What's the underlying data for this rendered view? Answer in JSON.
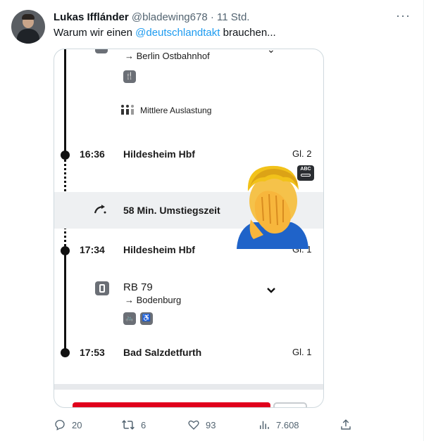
{
  "tweet": {
    "name": "Lukas Ifflánder",
    "handle": "@bladewing678",
    "separator": "·",
    "time": "11 Std.",
    "more": "···",
    "text_before": "Warum wir einen ",
    "mention": "@deutschlandtakt",
    "text_after": " brauchen..."
  },
  "journey": {
    "first_direction": "→ Berlin Ostbahnhof",
    "occupancy": "Mittlere Auslastung",
    "stop1": {
      "time": "16:36",
      "station": "Hildesheim Hbf",
      "platform": "Gl. 2"
    },
    "transfer": "58 Min. Umstiegszeit",
    "stop2": {
      "time": "17:34",
      "station": "Hildesheim Hbf",
      "platform": "Gl. 1"
    },
    "train": {
      "line": "RB 79",
      "direction": "→ Bodenburg"
    },
    "stop3": {
      "time": "17:53",
      "station": "Bad Salzdetfurth",
      "platform": "Gl. 1"
    },
    "platform_icon_text": "ABC"
  },
  "actions": {
    "replies": "20",
    "retweets": "6",
    "likes": "93",
    "views": "7.608"
  },
  "colors": {
    "link": "#1d9bf0",
    "muted": "#536471",
    "db_red": "#e0001c"
  }
}
